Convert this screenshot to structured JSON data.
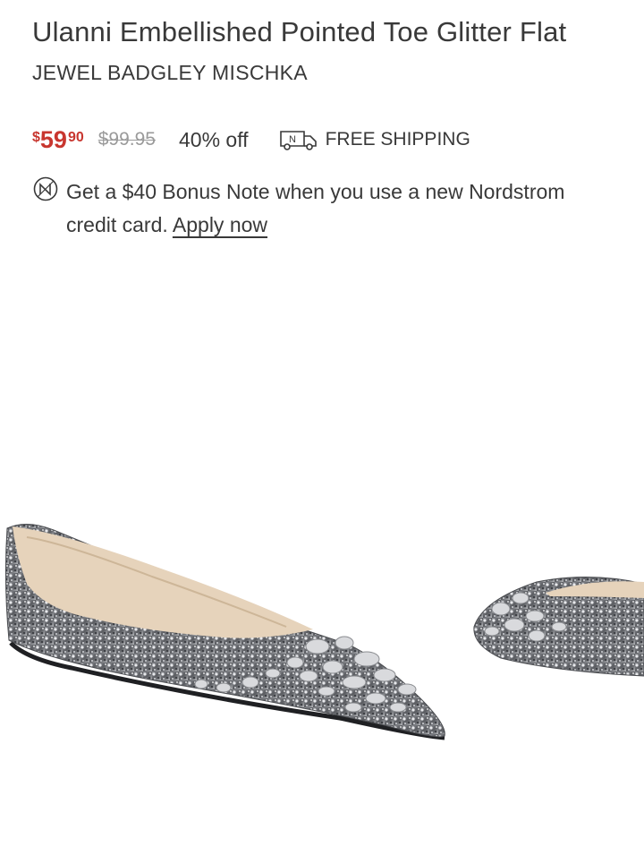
{
  "product": {
    "title": "Ulanni Embellished Pointed Toe Glitter Flat",
    "brand": "JEWEL BADGLEY MISCHKA"
  },
  "pricing": {
    "currency_symbol": "$",
    "sale_dollars": "59",
    "sale_cents": "90",
    "original_price": "$99.95",
    "discount": "40% off",
    "sale_color": "#c8362f"
  },
  "shipping": {
    "icon": "delivery-truck-icon",
    "icon_letter": "N",
    "label": "FREE SHIPPING"
  },
  "promo": {
    "icon": "nordstrom-note-icon",
    "text": "Get a $40 Bonus Note when you use a new Nordstrom credit card. ",
    "link_label": "Apply now"
  },
  "image": {
    "subject": "silver-glitter-flat-shoes-image"
  }
}
